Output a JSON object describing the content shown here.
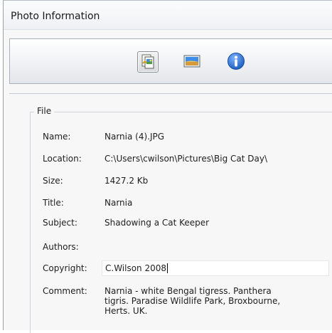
{
  "window": {
    "title": "Photo Information"
  },
  "toolbar": {
    "buttons": [
      {
        "icon": "file-properties-icon",
        "active": true
      },
      {
        "icon": "picture-icon",
        "active": false
      },
      {
        "icon": "info-icon",
        "active": false
      }
    ]
  },
  "file": {
    "group_label": "File",
    "name_label": "Name:",
    "name_value": "Narnia (4).JPG",
    "location_label": "Location:",
    "location_value": "C:\\Users\\cwilson\\Pictures\\Big Cat Day\\",
    "size_label": "Size:",
    "size_value": "1427.2 Kb",
    "title_label": "Title:",
    "title_value": "Narnia",
    "subject_label": "Subject:",
    "subject_value": "Shadowing a Cat Keeper",
    "authors_label": "Authors:",
    "authors_value": "",
    "copyright_label": "Copyright:",
    "copyright_value": "C.Wilson 2008",
    "comment_label": "Comment:",
    "comment_value": "Narnia - white Bengal tigress. Panthera\ntigris. Paradise Wildlife Park, Broxbourne,\nHerts. UK."
  },
  "colors": {
    "info_blue": "#1f5fbf",
    "accent_frame": "#aab2bb"
  }
}
